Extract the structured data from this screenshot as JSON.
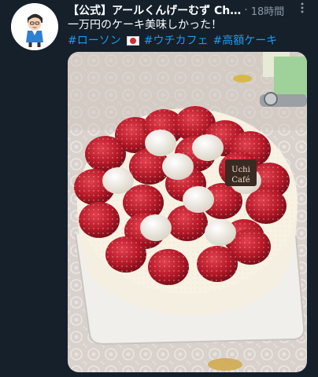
{
  "tweet": {
    "display_name": "【公式】アールくんげーむず Ch…",
    "separator": "·",
    "timestamp": "18時間",
    "more_icon": "more-vertical-icon",
    "text": "一万円のケーキ美味しかった！",
    "hashtags": [
      "#ローソン",
      "#ウチカフェ",
      "#高額ケーキ"
    ],
    "flag_icon": "japan-flag-emoji",
    "avatar_icon": "cartoon-character-avatar",
    "colors": {
      "background": "#15202b",
      "link": "#1d9bf0",
      "secondary_text": "#8b98a5"
    }
  },
  "media": {
    "logo_line1": "Uchi",
    "logo_line2": "Café"
  }
}
